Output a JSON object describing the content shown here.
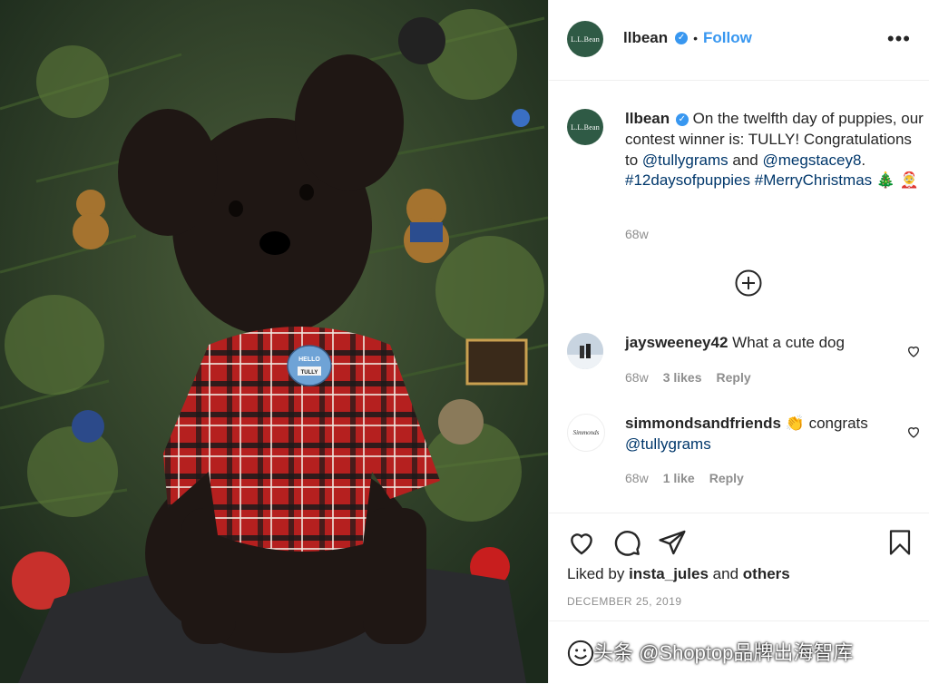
{
  "post": {
    "author": "llbean",
    "author_avatar_text": "L.L.Bean",
    "separator": "•",
    "follow_label": "Follow",
    "more_label": "•••",
    "caption_parts": {
      "intro": "On the twelfth day of puppies, our contest winner is: TULLY! Congratulations to",
      "mention1": "@tullygrams",
      "and": "and",
      "mention2": "@megstacey8",
      "period": ".",
      "tag1": "#12daysofpuppies",
      "tag2": "#MerryChristmas",
      "emoji": "🎄 🤶"
    },
    "caption_time": "68w",
    "liked_by_prefix": "Liked by",
    "liked_by_user": "insta_jules",
    "liked_by_and": "and",
    "liked_by_others": "others",
    "date": "DECEMBER 25, 2019"
  },
  "photo": {
    "tag_line1": "HELLO",
    "tag_line2": "TULLY"
  },
  "comments": [
    {
      "user": "jaysweeney42",
      "text": "What a cute dog",
      "time": "68w",
      "likes": "3 likes",
      "reply": "Reply"
    },
    {
      "user": "simmondsandfriends",
      "emoji": "👏",
      "text": "congrats",
      "mention": "@tullygrams",
      "time": "68w",
      "likes": "1 like",
      "reply": "Reply",
      "avatar_text": "Simmonds"
    }
  ],
  "watermark": "头条 @Shoptop品牌出海智库",
  "colors": {
    "accent": "#3897f0",
    "link": "#00376b",
    "muted": "#8e8e8e",
    "text": "#262626",
    "avatar_green": "#2f5a45"
  },
  "icons": [
    "more-icon",
    "verified-icon",
    "add-comments-icon",
    "heart-icon",
    "comment-icon",
    "share-icon",
    "bookmark-icon",
    "emoji-icon"
  ]
}
